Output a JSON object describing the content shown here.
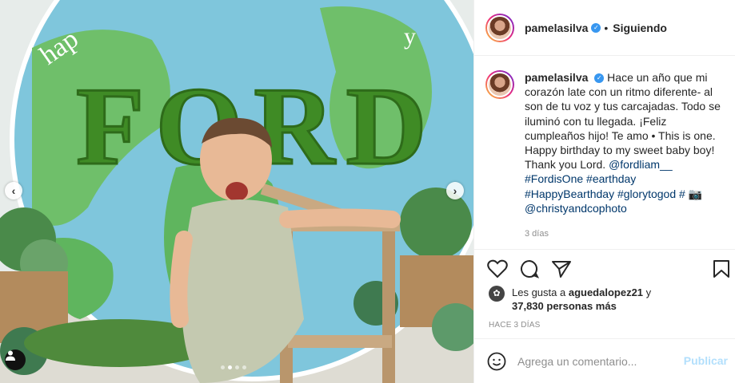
{
  "header": {
    "username": "pamelasilva",
    "separator": "•",
    "follow_status": "Siguiendo"
  },
  "caption": {
    "username": "pamelasilva",
    "text_1": "Hace un año que mi corazón late con un ritmo diferente- al son de tu voz y tus carcajadas. Todo se iluminó con tu llegada. ¡Feliz cumpleaños hijo! Te amo • This is one. Happy birthday to my sweet baby boy! Thank you Lord.",
    "mention_1": "@fordliam__",
    "hashtags": "#FordisOne #earthday #HappyBearthday #glorytogod #",
    "camera": "📷",
    "mention_2": "@christyandcophoto",
    "time": "3 días"
  },
  "image": {
    "top_text": "hap",
    "right_text": "y",
    "main_text": "FORD"
  },
  "likes": {
    "prefix": "Les gusta a",
    "user": "aguedalopez21",
    "mid": "y",
    "count": "37,830 personas más"
  },
  "posted_ago": "HACE 3 DÍAS",
  "comment": {
    "placeholder": "Agrega un comentario...",
    "publish": "Publicar"
  },
  "carousel": {
    "count": 4,
    "active": 1
  },
  "colors": {
    "verified": "#3897f0",
    "link": "#00376b",
    "publish": "#b2dffc"
  }
}
